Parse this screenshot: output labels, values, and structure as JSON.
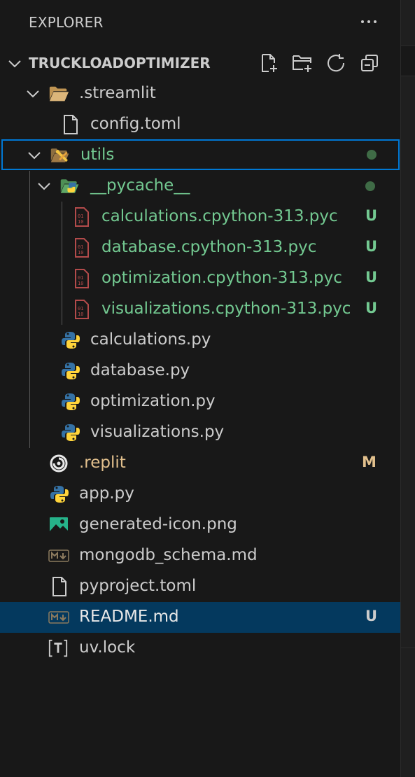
{
  "explorer": {
    "title": "EXPLORER",
    "more_icon": "ellipsis-icon"
  },
  "root": {
    "label": "TRUCKLOADOPTIMIZER",
    "actions": [
      {
        "name": "new-file-icon"
      },
      {
        "name": "new-folder-icon"
      },
      {
        "name": "refresh-icon"
      },
      {
        "name": "collapse-all-icon"
      }
    ]
  },
  "tree": {
    "streamlit": {
      "label": ".streamlit"
    },
    "config_toml": {
      "label": "config.toml"
    },
    "utils": {
      "label": "utils"
    },
    "pycache": {
      "label": "__pycache__"
    },
    "calc_pyc": {
      "label": "calculations.cpython-313.pyc",
      "badge": "U"
    },
    "db_pyc": {
      "label": "database.cpython-313.pyc",
      "badge": "U"
    },
    "opt_pyc": {
      "label": "optimization.cpython-313.pyc",
      "badge": "U"
    },
    "vis_pyc": {
      "label": "visualizations.cpython-313.pyc",
      "badge": "U"
    },
    "calc_py": {
      "label": "calculations.py"
    },
    "db_py": {
      "label": "database.py"
    },
    "opt_py": {
      "label": "optimization.py"
    },
    "vis_py": {
      "label": "visualizations.py"
    },
    "replit": {
      "label": ".replit",
      "badge": "M"
    },
    "app_py": {
      "label": "app.py"
    },
    "icon_png": {
      "label": "generated-icon.png"
    },
    "mongo_md": {
      "label": "mongodb_schema.md"
    },
    "pyproject": {
      "label": "pyproject.toml"
    },
    "readme": {
      "label": "README.md",
      "badge": "U"
    },
    "uvlock": {
      "label": "uv.lock"
    }
  },
  "colors": {
    "background": "#181818",
    "text": "#cccccc",
    "git_untracked": "#73c991",
    "git_modified": "#e2c08d",
    "selection_outline": "#0078d4",
    "selection_fill": "#04395e"
  }
}
